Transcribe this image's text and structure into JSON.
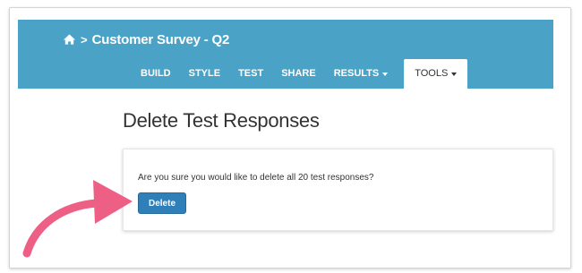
{
  "header": {
    "title": "Customer Survey - Q2",
    "separator": ">",
    "home_icon": "home-icon",
    "background": "#4aa3c6"
  },
  "tabs": [
    {
      "label": "BUILD",
      "active": false,
      "dropdown": false
    },
    {
      "label": "STYLE",
      "active": false,
      "dropdown": false
    },
    {
      "label": "TEST",
      "active": false,
      "dropdown": false
    },
    {
      "label": "SHARE",
      "active": false,
      "dropdown": false
    },
    {
      "label": "RESULTS",
      "active": false,
      "dropdown": true
    },
    {
      "label": "TOOLS",
      "active": true,
      "dropdown": true
    }
  ],
  "main": {
    "page_title": "Delete Test Responses",
    "confirm_text": "Are you sure you would like to delete all 20 test responses?",
    "delete_label": "Delete",
    "delete_color": "#2f7fb8"
  },
  "annotation": {
    "arrow_color": "#ee5f86",
    "arrow_icon": "pointer-arrow-icon"
  }
}
